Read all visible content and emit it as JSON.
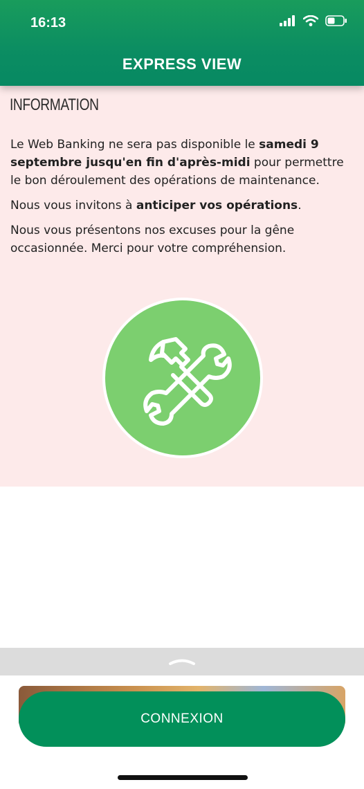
{
  "status_bar": {
    "time": "16:13",
    "icons": [
      "signal-icon",
      "wifi-icon",
      "battery-icon"
    ]
  },
  "header": {
    "title": "EXPRESS VIEW",
    "background": "#0b8d62"
  },
  "info": {
    "heading": "INFORMATION",
    "p1_text_a": "Le Web Banking ne sera pas disponible le ",
    "p1_bold": "samedi 9 septembre jusqu'en fin d'après-midi",
    "p1_text_b": " pour permettre le bon déroulement des opérations de maintenance.",
    "p2_text_a": "Nous vous invitons à ",
    "p2_bold": "anticiper vos opérations",
    "p2_text_b": ".",
    "p3": "Nous vous présentons nos excuses pour la gêne occasionnée. Merci pour votre compréhension.",
    "background": "#fdeaea",
    "icon": "tools-icon",
    "icon_color": "#7ccf6f"
  },
  "drawer": {
    "icon": "chevron-up-icon"
  },
  "bottom": {
    "connexion_label": "CONNEXION",
    "button_color": "#02905a"
  }
}
